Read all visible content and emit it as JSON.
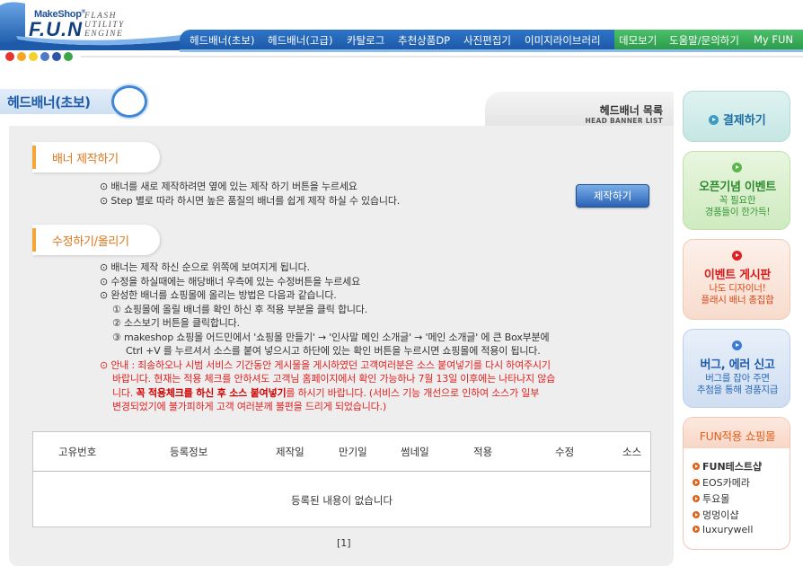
{
  "header": {
    "logo_make": "MakeShop",
    "logo_fun": "F.U.N",
    "logo_tag": [
      "FLASH",
      "UTILITY",
      "ENGINE"
    ],
    "nav": [
      "헤드배너(초보)",
      "헤드배너(고급)",
      "카탈로그",
      "추천상품DP",
      "사진편집기",
      "이미지라이브러리",
      "데모보기",
      "도움말/문의하기",
      "My FUN"
    ],
    "colors": {
      "nav_blue": "#2d74c8",
      "nav_green": "#3fae5a"
    },
    "dot_colors": [
      "#e3342f",
      "#f6a623",
      "#f2d22e",
      "#4d79c7",
      "#2e56a6",
      "#3aa64a"
    ]
  },
  "page": {
    "title": "헤드배너(초보)",
    "list_head_ko": "헤드배너 목록",
    "list_head_en": "HEAD BANNER LIST"
  },
  "section_make": {
    "label": "배너 제작하기",
    "lines": [
      "⊙ 배너를 새로 제작하려면 옆에 있는 제작 하기 버튼을 누르세요",
      "⊙ Step 별로 따라 하시면 높은 품질의 배너를 쉽게 제작 하실 수 있습니다."
    ],
    "button": "제작하기"
  },
  "section_edit": {
    "label": "수정하기/올리기",
    "lines": [
      "⊙ 배너는 제작 하신 순으로 위쪽에 보여지게 됩니다.",
      "⊙ 수정을 하실때에는 해당배너 우측에 있는 수정버튼을 누르세요",
      "⊙ 완성한 배너를 쇼핑몰에 올리는 방법은 다음과 같습니다.",
      "① 쇼핑몰에 올릴 배너를 확인 하신 후 적용 부분을 클릭 합니다.",
      "② 소스보기 버튼을 클릭합니다.",
      "③ makeshop 쇼핑몰 어드민에서 '쇼핑몰 만들기' → '인사말 메인 소개글' → '메인 소개글' 에 큰 Box부분에",
      "Ctrl +V 를 누르셔서 소스를 붙여 넣으시고 하단에 있는 확인 버튼을 누르시면 쇼핑몰에 적용이 됩니다."
    ],
    "notice_1": "⊙ 안내 : 죄송하오나 시범 서비스 기간동안 게시물을 게시하였던 고객여러분은 소스 붙여넣기를 다시 하여주시기",
    "notice_2": "바랍니다. 현재는 적용 체크를 안하셔도 고객님 홈페이지에서 확인 가능하나 7월 13일 이후에는 나타나지 않습",
    "notice_3a": "니다. ",
    "notice_3b": "꼭 적용체크를 하신 후 소스 붙여넣기",
    "notice_3c": "를 하시기 바랍니다. (서비스 기능 개선으로 인하여 소스가 일부",
    "notice_4": "변경되었기에 불가피하게 고객 여러분께 불편을 드리게 되었습니다.)"
  },
  "table": {
    "columns": [
      "고유번호",
      "등록정보",
      "제작일",
      "만기일",
      "썸네일",
      "적용",
      "수정",
      "소스"
    ],
    "empty_text": "등록된 내용이 없습니다",
    "pager": "[1]"
  },
  "sidebar": {
    "pay": "결제하기",
    "open_event": {
      "title": "오픈기념 이벤트",
      "sub": [
        "꼭 필요한",
        "경품들이 한가득!"
      ]
    },
    "event_board": {
      "title": "이벤트 게시판",
      "sub": [
        "나도 디자이너!",
        "플래시 배너 총집합"
      ]
    },
    "bug_report": {
      "title": "버그, 에러 신고",
      "sub": [
        "버그를 잡아 주면",
        "추첨을 통해 경품지급"
      ]
    },
    "shops": {
      "title": "FUN적용 쇼핑몰",
      "items": [
        "FUN테스트샵",
        "EOS카메라",
        "투요몰",
        "멍멍이샵",
        "luxurywell"
      ]
    }
  }
}
